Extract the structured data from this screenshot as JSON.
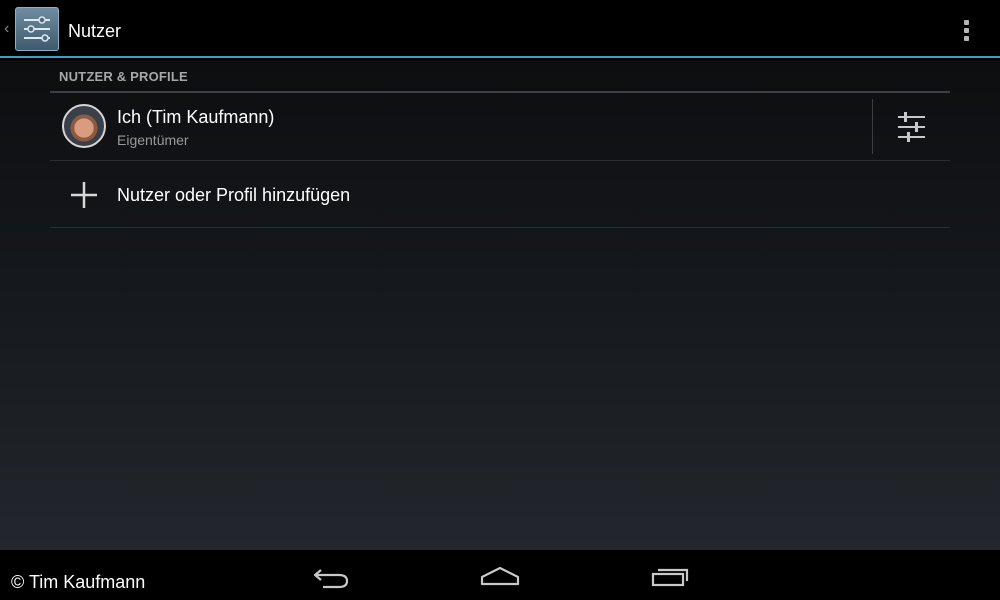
{
  "action_bar": {
    "title": "Nutzer",
    "accent_color": "#33a3cc",
    "app_icon": "settings-sliders-icon",
    "overflow_icon": "overflow-menu-icon"
  },
  "section": {
    "header": "NUTZER & PROFILE"
  },
  "users": [
    {
      "name": "Ich (Tim Kaufmann)",
      "role": "Eigentümer",
      "avatar": "user-photo-avatar",
      "settings_icon": "user-settings-sliders-icon"
    }
  ],
  "add_row": {
    "label": "Nutzer oder Profil hinzufügen",
    "icon": "plus-icon"
  },
  "nav_bar": {
    "copyright": "© Tim Kaufmann",
    "buttons": [
      "back-icon",
      "home-icon",
      "recent-apps-icon"
    ]
  }
}
